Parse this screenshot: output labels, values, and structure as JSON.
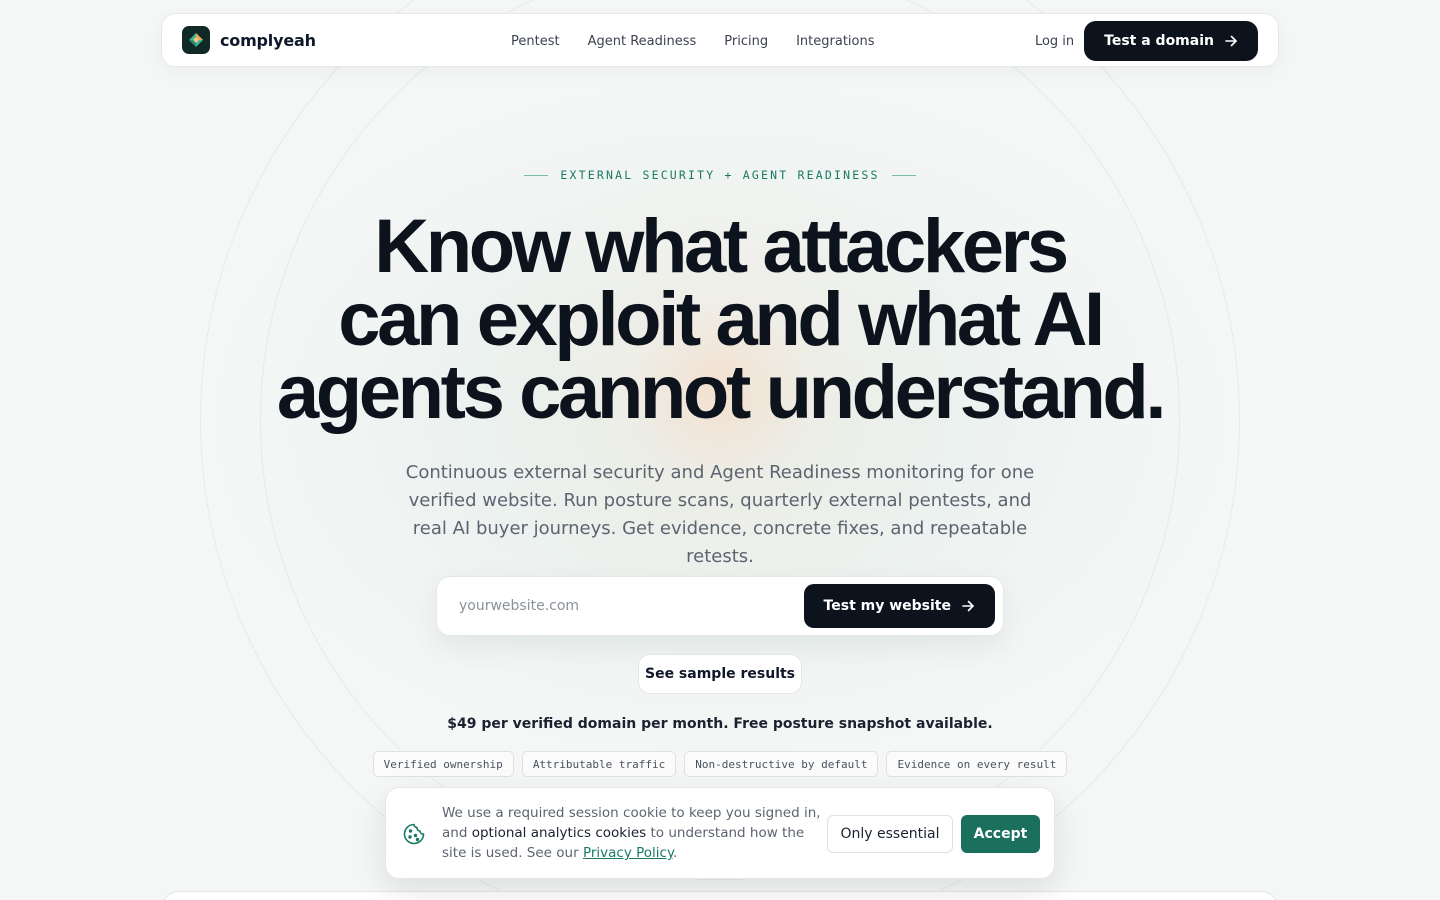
{
  "nav": {
    "brand": "complyeah",
    "links": [
      "Pentest",
      "Agent Readiness",
      "Pricing",
      "Integrations"
    ],
    "login": "Log in",
    "cta": "Test a domain"
  },
  "hero": {
    "eyebrow": "EXTERNAL SECURITY + AGENT READINESS",
    "headline": [
      "Know what attackers",
      "can exploit and what AI",
      "agents cannot understand."
    ],
    "subhead": "Continuous external security and Agent Readiness monitoring for one verified website. Run posture scans, quarterly external pentests, and real AI buyer journeys. Get evidence, concrete fixes, and repeatable retests.",
    "search": {
      "placeholder": "yourwebsite.com",
      "value": "",
      "button": "Test my website"
    },
    "secondary_button": "See sample results",
    "pricing_note": "$49 per verified domain per month. Free posture snapshot available.",
    "chips": [
      "Verified ownership",
      "Attributable traffic",
      "Non-destructive by default",
      "Evidence on every result"
    ]
  },
  "cookie": {
    "text_before": "We use a required session cookie to keep you signed in, and ",
    "text_strong": "optional analytics cookies",
    "text_after": " to understand how the site is used. See our ",
    "link": "Privacy Policy",
    "text_end": ".",
    "essential_button": "Only essential",
    "accept_button": "Accept"
  },
  "colors": {
    "accent": "#197a63",
    "accept": "#1a6f5d",
    "dark": "#0d131c",
    "background": "#f5f7f6"
  }
}
